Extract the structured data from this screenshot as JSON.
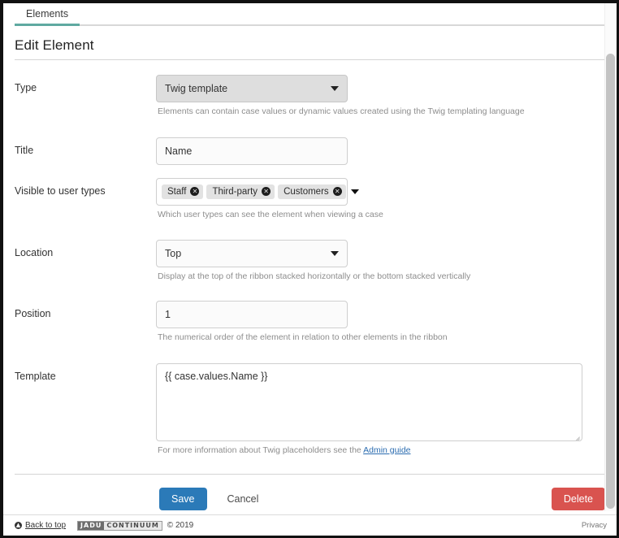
{
  "tabs": [
    {
      "label": "Elements",
      "active": true
    }
  ],
  "page": {
    "heading": "Edit Element"
  },
  "form": {
    "type": {
      "label": "Type",
      "value": "Twig template",
      "help": "Elements can contain case values or dynamic values created using the Twig templating language"
    },
    "title": {
      "label": "Title",
      "value": "Name"
    },
    "visible": {
      "label": "Visible to user types",
      "tags": [
        "Staff",
        "Third-party",
        "Customers"
      ],
      "remove_glyph": "✕",
      "help": "Which user types can see the element when viewing a case"
    },
    "location": {
      "label": "Location",
      "value": "Top",
      "help": "Display at the top of the ribbon stacked horizontally or the bottom stacked vertically"
    },
    "position": {
      "label": "Position",
      "value": "1",
      "help": "The numerical order of the element in relation to other elements in the ribbon"
    },
    "template": {
      "label": "Template",
      "value": "{{ case.values.Name }}",
      "help_prefix": "For more information about Twig placeholders see the ",
      "help_link": "Admin guide"
    }
  },
  "actions": {
    "save": "Save",
    "cancel": "Cancel",
    "delete": "Delete"
  },
  "footer": {
    "back_to_top": "Back to top",
    "up_glyph": "▲",
    "logo_first": "JADU",
    "logo_second": "CONTINUUM",
    "copyright": "© 2019",
    "privacy": "Privacy"
  },
  "colors": {
    "tab_accent": "#5fa9a1",
    "primary": "#2b7ab8",
    "danger": "#d9534f",
    "link": "#2b6cb0"
  }
}
